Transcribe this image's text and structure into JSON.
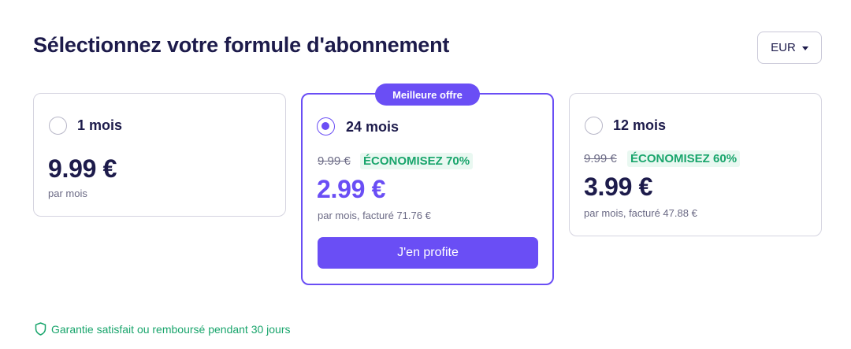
{
  "header": {
    "title": "Sélectionnez votre formule d'abonnement",
    "currency": "EUR"
  },
  "plans": [
    {
      "label": "1 mois",
      "price": "9.99 €",
      "subtext": "par mois",
      "selected": false
    },
    {
      "label": "24 mois",
      "badge": "Meilleure offre",
      "old_price": "9.99 €",
      "savings": "ÉCONOMISEZ 70%",
      "price": "2.99 €",
      "subtext": "par mois, facturé 71.76 €",
      "cta": "J'en profite",
      "selected": true
    },
    {
      "label": "12 mois",
      "old_price": "9.99 €",
      "savings": "ÉCONOMISEZ 60%",
      "price": "3.99 €",
      "subtext": "par mois, facturé 47.88 €",
      "selected": false
    }
  ],
  "footer": {
    "guarantee": "Garantie satisfait ou remboursé pendant 30 jours",
    "icon": "shield-icon"
  },
  "colors": {
    "accent": "#6a4ef5",
    "text": "#1d1b4b",
    "success": "#19a56c"
  }
}
